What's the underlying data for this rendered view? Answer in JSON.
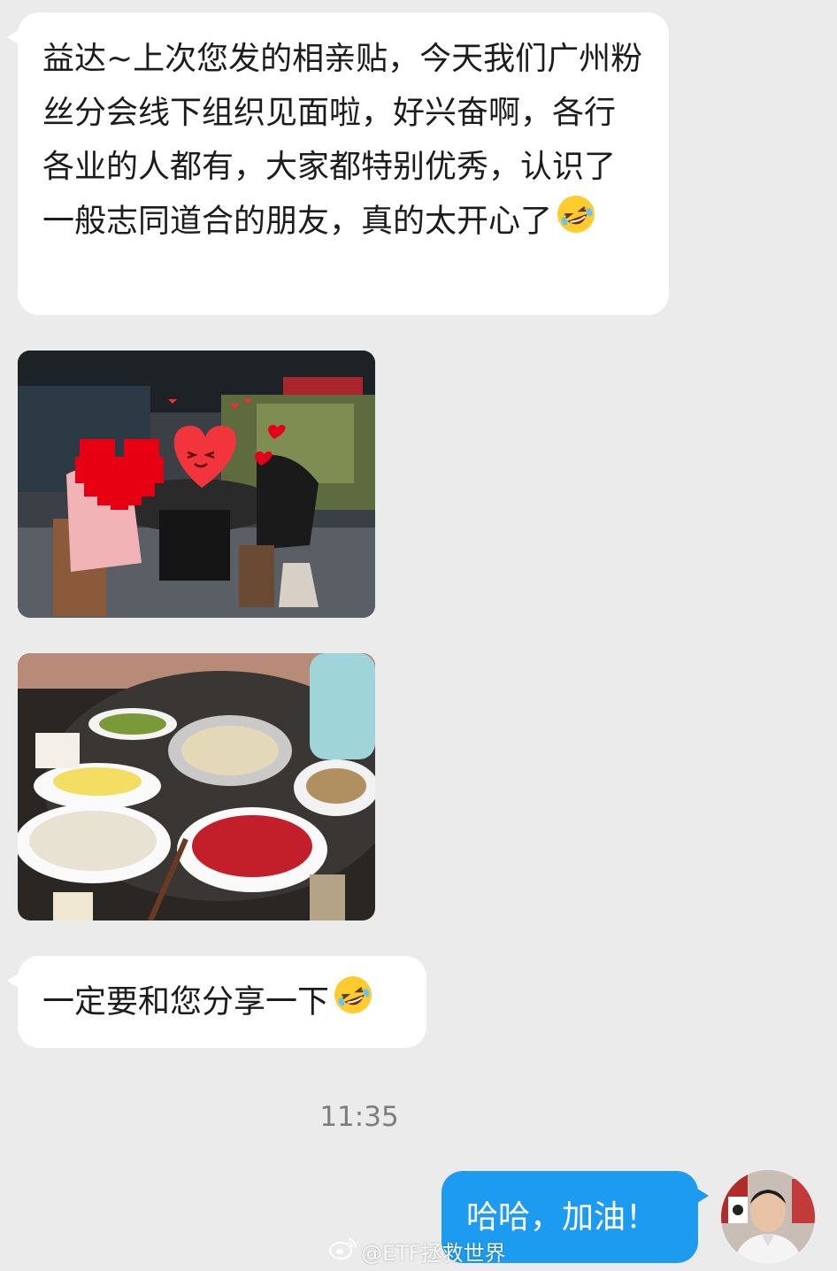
{
  "messages": {
    "msg1": "益达~上次您发的相亲贴，今天我们广州粉丝分会线下组织见面啦，好兴奋啊，各行各业的人都有，大家都特别优秀，认识了一般志同道合的朋友，真的太开心了",
    "msg2": "一定要和您分享一下",
    "timestamp": "11:35",
    "reply": "哈哈，加油！"
  },
  "watermark": "@ETF拯救世界",
  "icons": {
    "laugh_emoji": "rolling-on-floor-laughing",
    "heart_sticker": "heart-eyes",
    "weibo_logo": "weibo-eye"
  },
  "colors": {
    "background": "#ebebeb",
    "incoming_bubble": "#ffffff",
    "outgoing_bubble": "#1d9bf0",
    "timestamp": "#7d7d7d"
  }
}
